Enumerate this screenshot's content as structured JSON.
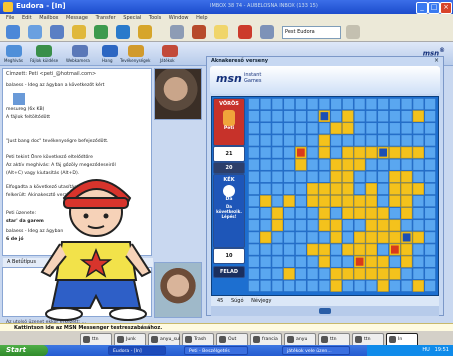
{
  "app": {
    "title": "Eudora - [In]",
    "address_fragment": "IMBOX 38 74 - AUBELOSNA INBOX (133 15)",
    "menu": [
      "File",
      "Edit",
      "Mailbox",
      "Message",
      "Transfer",
      "Special",
      "Tools",
      "Window",
      "Help"
    ],
    "mailbox_select": "Pest Eudora"
  },
  "messenger": {
    "toolbar": [
      "Meghívás",
      "Fájlok küldése",
      "Webkamera",
      "Hang",
      "Tevékenységek",
      "Játékok"
    ],
    "to_line": "Címzett: Peti <peti_@hotmail.com>",
    "lines": [
      "balaess - Ideg az ágyban a következőt kért",
      "mesureg (6x KB)",
      "A fájlok feltöltődött",
      "\"Just bang doc\" tevékenységre befejeződött.",
      "Peti tekint Önre következő eltelődtőre",
      "Az aktív meghívás: A fáj gőzöly megeződeseiről",
      "(Alt+C) vagy kiutasítás (Alt+D).",
      "Elfogadta a következő utasítást",
      "felkerült: Akinakesztő verzió",
      "Peti üzenete:",
      "star' da garem",
      "balaess - Ideg az ágyban",
      "6 de jó"
    ],
    "format_label": "A Betűtípus",
    "status": "Az utolsó üzenet ekkor érkezett: ...",
    "tip": "Kattintson ide az MSN Messenger testreszabásához."
  },
  "game": {
    "window_title": "Aknakereső verseny",
    "brand": "msn",
    "brand_sub": [
      "instant",
      "Games"
    ],
    "red_player": "VÖRÖS",
    "red_name": "Peti",
    "score_red": "21",
    "count": "20",
    "blue_player": "KÉK",
    "blue_name": "Da",
    "blue_text": "Da következik. Lépés!",
    "score_blue": "10",
    "give_up": "FELAD",
    "footer": [
      "45",
      "Súgó",
      "Névjegy"
    ]
  },
  "tabs": [
    "ttn",
    "Junk",
    "anyu_sul",
    "Trash",
    "Out",
    "francia",
    "anyu",
    "ttn",
    "ttn",
    "In"
  ],
  "tab_selected_index": 9,
  "taskbar": {
    "start": "Start",
    "tasks": [
      "Eudora - [In]",
      "Peti - Beszélgetés",
      "játékok vele üzen..."
    ],
    "clock": "19:51",
    "lang": "HU"
  },
  "colors": {
    "board": "#1d6fd0",
    "red_flag": "#d93a1b",
    "blue_flag": "#1b4fb5",
    "revealed": "#f4c21c"
  }
}
